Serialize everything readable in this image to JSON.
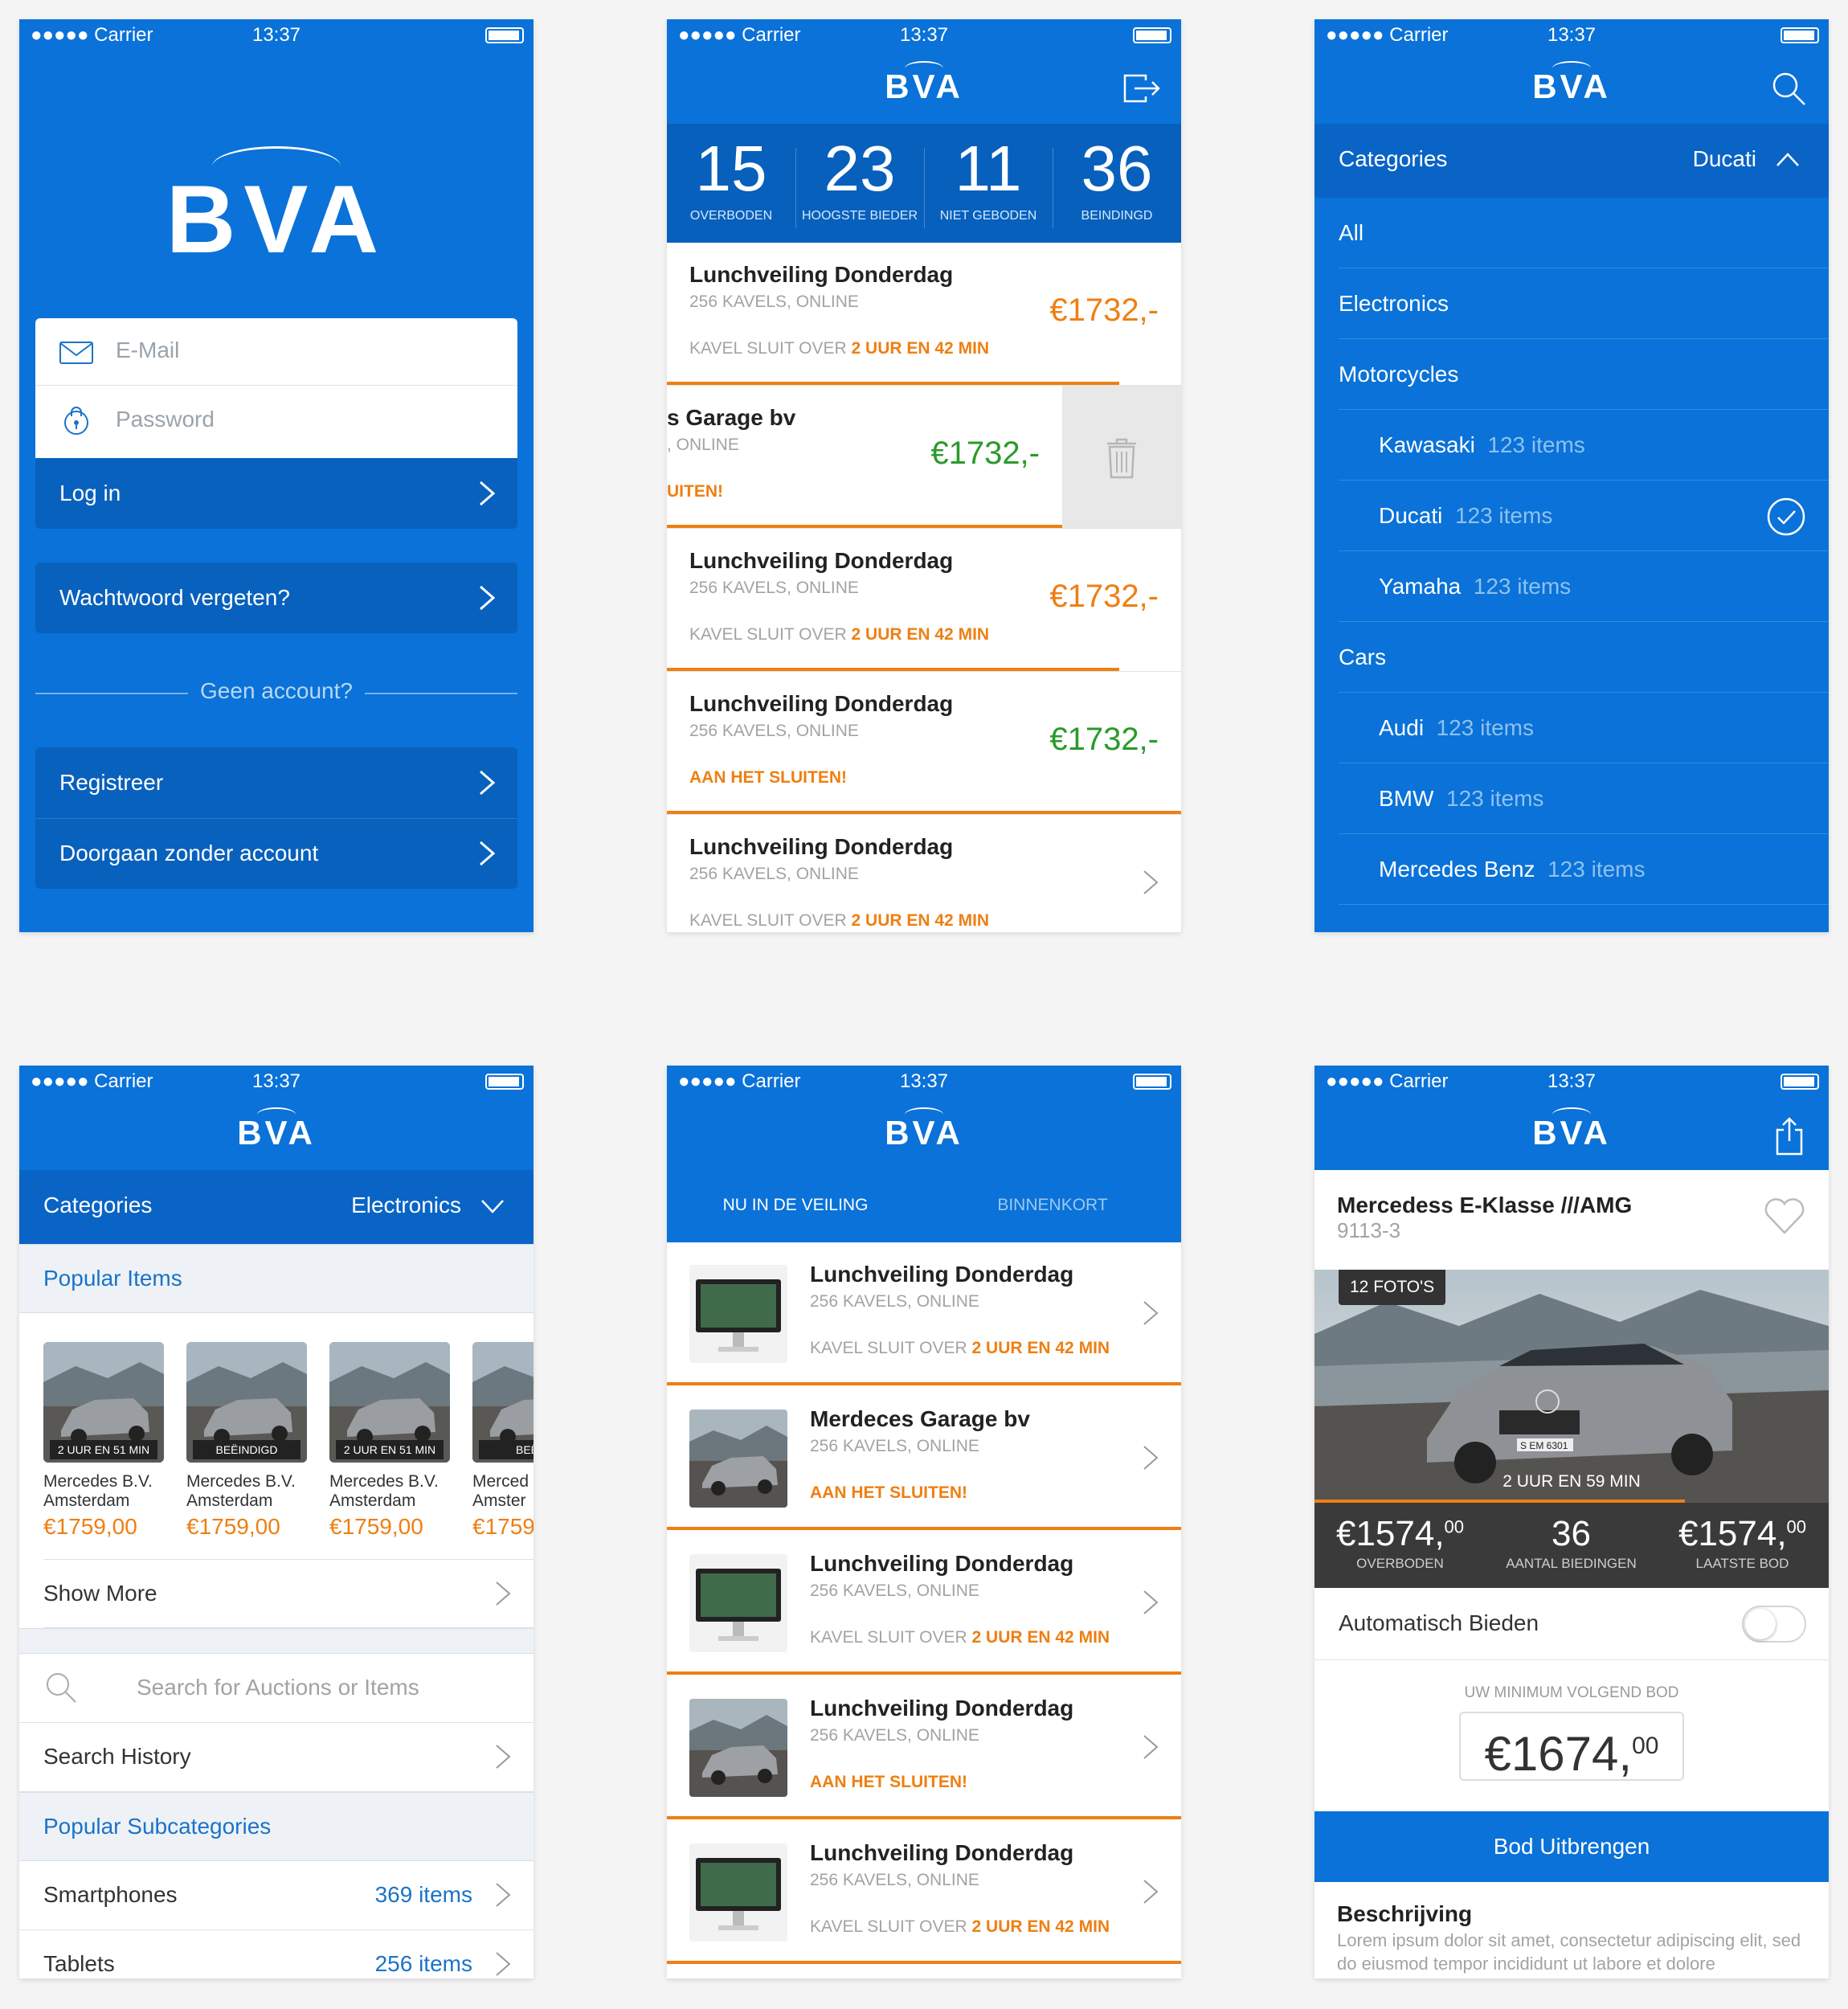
{
  "status": {
    "carrier": "●●●●● Carrier",
    "time": "13:37"
  },
  "brand": {
    "logo": "BVA"
  },
  "colors": {
    "brand_blue": "#0a72d8",
    "accent_orange": "#ee7f12",
    "price_green": "#2a9a2a"
  },
  "login": {
    "email_placeholder": "E-Mail",
    "password_placeholder": "Password",
    "login_label": "Log in",
    "forgot_label": "Wachtwoord vergeten?",
    "no_account": "Geen account?",
    "register_label": "Registreer",
    "guest_label": "Doorgaan zonder account"
  },
  "dashboard": {
    "stats": [
      {
        "value": "15",
        "label": "OVERBODEN"
      },
      {
        "value": "23",
        "label": "HOOGSTE BIEDER"
      },
      {
        "value": "11",
        "label": "NIET GEBODEN"
      },
      {
        "value": "36",
        "label": "BEINDINGD"
      }
    ],
    "auctions": [
      {
        "title": "Lunchveiling Donderdag",
        "sub": "256 KAVELS, ONLINE",
        "closes_prefix": "KAVEL SLUIT OVER",
        "closes_time": "2 UUR EN 42 MIN",
        "price": "€1732,-",
        "progress": 0.88
      },
      {
        "title": "s Garage bv",
        "sub": ", ONLINE",
        "closes_alert": "UITEN!",
        "price": "€1732,-",
        "progress": 1.0
      },
      {
        "title": "Lunchveiling Donderdag",
        "sub": "256 KAVELS, ONLINE",
        "closes_prefix": "KAVEL SLUIT OVER",
        "closes_time": "2 UUR EN 42 MIN",
        "price": "€1732,-",
        "progress": 0.88
      },
      {
        "title": "Lunchveiling Donderdag",
        "sub": "256 KAVELS, ONLINE",
        "closes_alert": "AAN HET SLUITEN!",
        "price": "€1732,-",
        "progress": 1.0
      },
      {
        "title": "Lunchveiling Donderdag",
        "sub": "256 KAVELS, ONLINE",
        "closes_prefix": "KAVEL SLUIT OVER",
        "closes_time": "2 UUR EN 42 MIN"
      }
    ]
  },
  "categories_screen": {
    "header_label": "Categories",
    "header_value": "Ducati",
    "rows": [
      {
        "name": "All",
        "level": 0,
        "count": ""
      },
      {
        "name": "Electronics",
        "level": 0,
        "count": ""
      },
      {
        "name": "Motorcycles",
        "level": 0,
        "count": ""
      },
      {
        "name": "Kawasaki",
        "level": 1,
        "count": "123 items"
      },
      {
        "name": "Ducati",
        "level": 1,
        "count": "123 items",
        "selected": true
      },
      {
        "name": "Yamaha",
        "level": 1,
        "count": "123 items"
      },
      {
        "name": "Cars",
        "level": 0,
        "count": ""
      },
      {
        "name": "Audi",
        "level": 1,
        "count": "123 items"
      },
      {
        "name": "BMW",
        "level": 1,
        "count": "123 items"
      },
      {
        "name": "Mercedes Benz",
        "level": 1,
        "count": "123 items"
      }
    ]
  },
  "browse": {
    "header_label": "Categories",
    "header_value": "Electronics",
    "popular_items_title": "Popular Items",
    "items": [
      {
        "tag": "2 UUR EN 51 MIN",
        "seller": "Mercedes B.V.",
        "city": "Amsterdam",
        "price": "€1759,00"
      },
      {
        "tag": "BEËINDIGD",
        "seller": "Mercedes B.V.",
        "city": "Amsterdam",
        "price": "€1759,00"
      },
      {
        "tag": "2 UUR EN 51 MIN",
        "seller": "Mercedes B.V.",
        "city": "Amsterdam",
        "price": "€1759,00"
      },
      {
        "tag": "BEËIN",
        "seller": "Merced",
        "city": "Amster",
        "price": "€1759"
      }
    ],
    "show_more": "Show More",
    "search_placeholder": "Search for Auctions or Items",
    "search_history": "Search History",
    "subcategories_title": "Popular Subcategories",
    "subcategories": [
      {
        "name": "Smartphones",
        "count": "369 items"
      },
      {
        "name": "Tablets",
        "count": "256 items"
      }
    ]
  },
  "auctions_list": {
    "tabs": [
      "NU IN DE VEILING",
      "BINNENKORT"
    ],
    "items": [
      {
        "title": "Lunchveiling Donderdag",
        "sub": "256 KAVELS, ONLINE",
        "closes_prefix": "KAVEL SLUIT OVER",
        "closes_time": "2 UUR EN 42 MIN",
        "image": "computer-image"
      },
      {
        "title": "Merdeces Garage bv",
        "sub": "256 KAVELS, ONLINE",
        "closes_alert": "AAN HET SLUITEN!",
        "image": "car-image"
      },
      {
        "title": "Lunchveiling Donderdag",
        "sub": "256 KAVELS, ONLINE",
        "closes_prefix": "KAVEL SLUIT OVER",
        "closes_time": "2 UUR EN 42 MIN",
        "image": "computer-image"
      },
      {
        "title": "Lunchveiling Donderdag",
        "sub": "256 KAVELS, ONLINE",
        "closes_alert": "AAN HET SLUITEN!",
        "image": "car-image"
      },
      {
        "title": "Lunchveiling Donderdag",
        "sub": "256 KAVELS, ONLINE",
        "closes_prefix": "KAVEL SLUIT OVER",
        "closes_time": "2 UUR EN 42 MIN",
        "image": "computer-image"
      }
    ]
  },
  "product": {
    "title": "Mercedess E-Klasse ///AMG",
    "sku": "9113-3",
    "photos": "12 FOTO'S",
    "countdown": "2 UUR EN 59 MIN",
    "plate": "S EM 6301",
    "progress": 0.72,
    "stats": [
      {
        "value": "€1574,",
        "sup": "00",
        "label": "OVERBODEN"
      },
      {
        "value": "36",
        "sup": "",
        "label": "AANTAL BIEDINGEN"
      },
      {
        "value": "€1574,",
        "sup": "00",
        "label": "LAATSTE BOD"
      }
    ],
    "auto_bid": "Automatisch Bieden",
    "auto_bid_on": false,
    "min_label": "UW MINIMUM VOLGEND BOD",
    "min_value": "€1674,",
    "min_sup": "00",
    "bid_button": "Bod Uitbrengen",
    "desc_title": "Beschrijving",
    "desc_text": "Lorem ipsum dolor sit amet, consectetur adipiscing elit, sed do eiusmod tempor incididunt ut labore et dolore"
  }
}
